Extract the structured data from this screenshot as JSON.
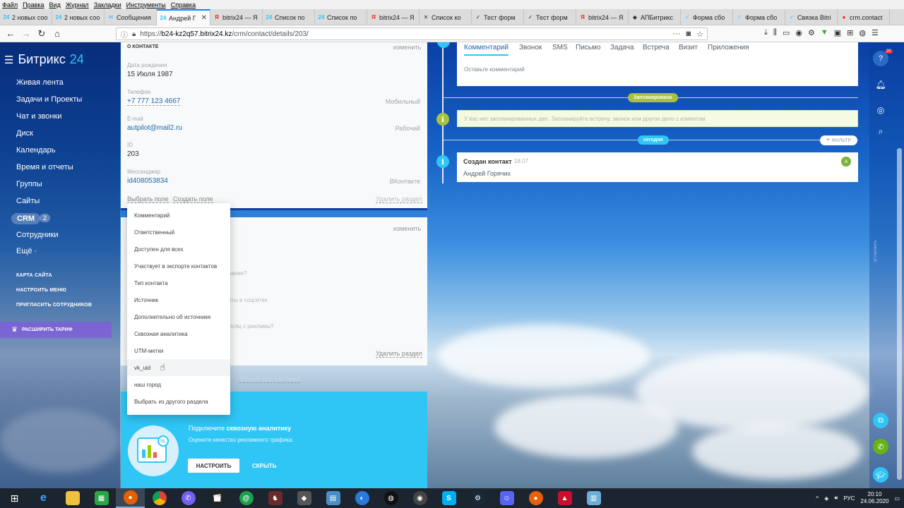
{
  "menubar": [
    "Файл",
    "Правка",
    "Вид",
    "Журнал",
    "Закладки",
    "Инструменты",
    "Справка"
  ],
  "tabs": [
    {
      "icon": "24",
      "icon_color": "#2fc6f6",
      "title": "2 новых соо",
      "active": false
    },
    {
      "icon": "24",
      "icon_color": "#2fc6f6",
      "title": "2 новых соо",
      "active": false
    },
    {
      "icon": "✉",
      "icon_color": "#2fc6f6",
      "title": "Сообщения",
      "active": false
    },
    {
      "icon": "24",
      "icon_color": "#2fc6f6",
      "title": "Андрей Г",
      "active": true
    },
    {
      "icon": "Я",
      "icon_color": "#e22",
      "title": "bitrix24 — Я",
      "active": false
    },
    {
      "icon": "24",
      "icon_color": "#2fc6f6",
      "title": "Список по",
      "active": false
    },
    {
      "icon": "24",
      "icon_color": "#2fc6f6",
      "title": "Список по",
      "active": false
    },
    {
      "icon": "Я",
      "icon_color": "#e22",
      "title": "bitrix24 — Я",
      "active": false
    },
    {
      "icon": "✕",
      "icon_color": "#333",
      "title": "Список ко",
      "active": false
    },
    {
      "icon": "✓",
      "icon_color": "#333",
      "title": "Тест форм",
      "active": false
    },
    {
      "icon": "✓",
      "icon_color": "#333",
      "title": "Тест форм",
      "active": false
    },
    {
      "icon": "Я",
      "icon_color": "#e22",
      "title": "bitrix24 — Я",
      "active": false
    },
    {
      "icon": "◆",
      "icon_color": "#333",
      "title": "АПБитрикс",
      "active": false
    },
    {
      "icon": "✓",
      "icon_color": "#2fc6f6",
      "title": "Форма сбо",
      "active": false
    },
    {
      "icon": "✓",
      "icon_color": "#2fc6f6",
      "title": "Форма сбо",
      "active": false
    },
    {
      "icon": "✓",
      "icon_color": "#2fc6f6",
      "title": "Связка Bitri",
      "active": false
    },
    {
      "icon": "●",
      "icon_color": "#e22",
      "title": "crm.contact",
      "active": false
    }
  ],
  "address": {
    "url_prefix": "https://",
    "url_domain": "b24-kz2q57.bitrix24.kz",
    "url_path": "/crm/contact/details/203/"
  },
  "sidebar": {
    "logo_brand": "Битрикс",
    "logo_num": "24",
    "items": [
      "Живая лента",
      "Задачи и Проекты",
      "Чат и звонки",
      "Диск",
      "Календарь",
      "Время и отчеты",
      "Группы",
      "Сайты",
      "CRM",
      "Сотрудники",
      "Ещё ·"
    ],
    "crm_count": "2",
    "links": [
      "КАРТА САЙТА",
      "НАСТРОИТЬ МЕНЮ",
      "ПРИГЛАСИТЬ СОТРУДНИКОВ"
    ],
    "tariff": "РАСШИРИТЬ ТАРИФ"
  },
  "contact": {
    "section_title": "О КОНТАКТЕ",
    "change": "изменить",
    "fields": [
      {
        "label": "Дата рождения",
        "value": "15 Июля 1987",
        "type": "",
        "link": false
      },
      {
        "label": "Телефон",
        "value": "+7 777 123 4667",
        "type": "Мобильный",
        "link": true
      },
      {
        "label": "E-mail",
        "value": "autpilot@mail2.ru",
        "type": "Рабочий",
        "link": true
      },
      {
        "label": "ID",
        "value": "203",
        "type": "",
        "link": false
      },
      {
        "label": "Мессенджер",
        "value": "id408053834",
        "type": "ВКонтакте",
        "link": true
      }
    ],
    "choose_field": "Выбрать поле",
    "create_field": "Создать поле",
    "delete_section": "Удалить раздел"
  },
  "section2": {
    "change": "изменить",
    "ghost_lines": [
      "ранее?",
      "нты в соцсетях",
      "месяц с рекламы?"
    ],
    "delete_section": "Удалить раздел",
    "common_view": "Общий вид карточки"
  },
  "dropdown": {
    "items": [
      "Комментарий",
      "Ответственный",
      "Доступен для всех",
      "Участвует в экспорте контактов",
      "Тип контакта",
      "Источник",
      "Дополнительно об источнике",
      "Сквозная аналитика",
      "UTM-метки",
      "vk_uid",
      "наш город",
      "Выбрать из другого раздела"
    ],
    "hover_index": 9
  },
  "promo": {
    "title_prefix": "Подключите ",
    "title_bold": "сквозную аналитику",
    "subtitle": "Оцените качество рекламного трафика.",
    "btn_setup": "НАСТРОИТЬ",
    "btn_hide": "СКРЫТЬ"
  },
  "feed": {
    "tabs": [
      "Комментарий",
      "Звонок",
      "SMS",
      "Письмо",
      "Задача",
      "Встреча",
      "Визит",
      "Приложения"
    ],
    "comment_placeholder": "Оставьте комментарий",
    "planned_pill": "Запланировано",
    "planned_empty": "У вас нет запланированных дел. Запланируйте встречу, звонок или другое дело с клиентом",
    "today_pill": "сегодня",
    "filter": "ФИЛЬТР",
    "created_title": "Создан контакт",
    "created_date": "18.07",
    "created_name": "Андрей Горячих",
    "avatar_letter": "А"
  },
  "rightbar": {
    "badge": "20",
    "side_text": "установить"
  },
  "taskbar": {
    "tray_lang": "РУС",
    "time": "20:10",
    "date": "24.06.2020"
  },
  "colors": {
    "accent": "#2fc6f6",
    "link": "#2067b0",
    "planned": "#a8c23b",
    "today": "#2fc6f6"
  }
}
